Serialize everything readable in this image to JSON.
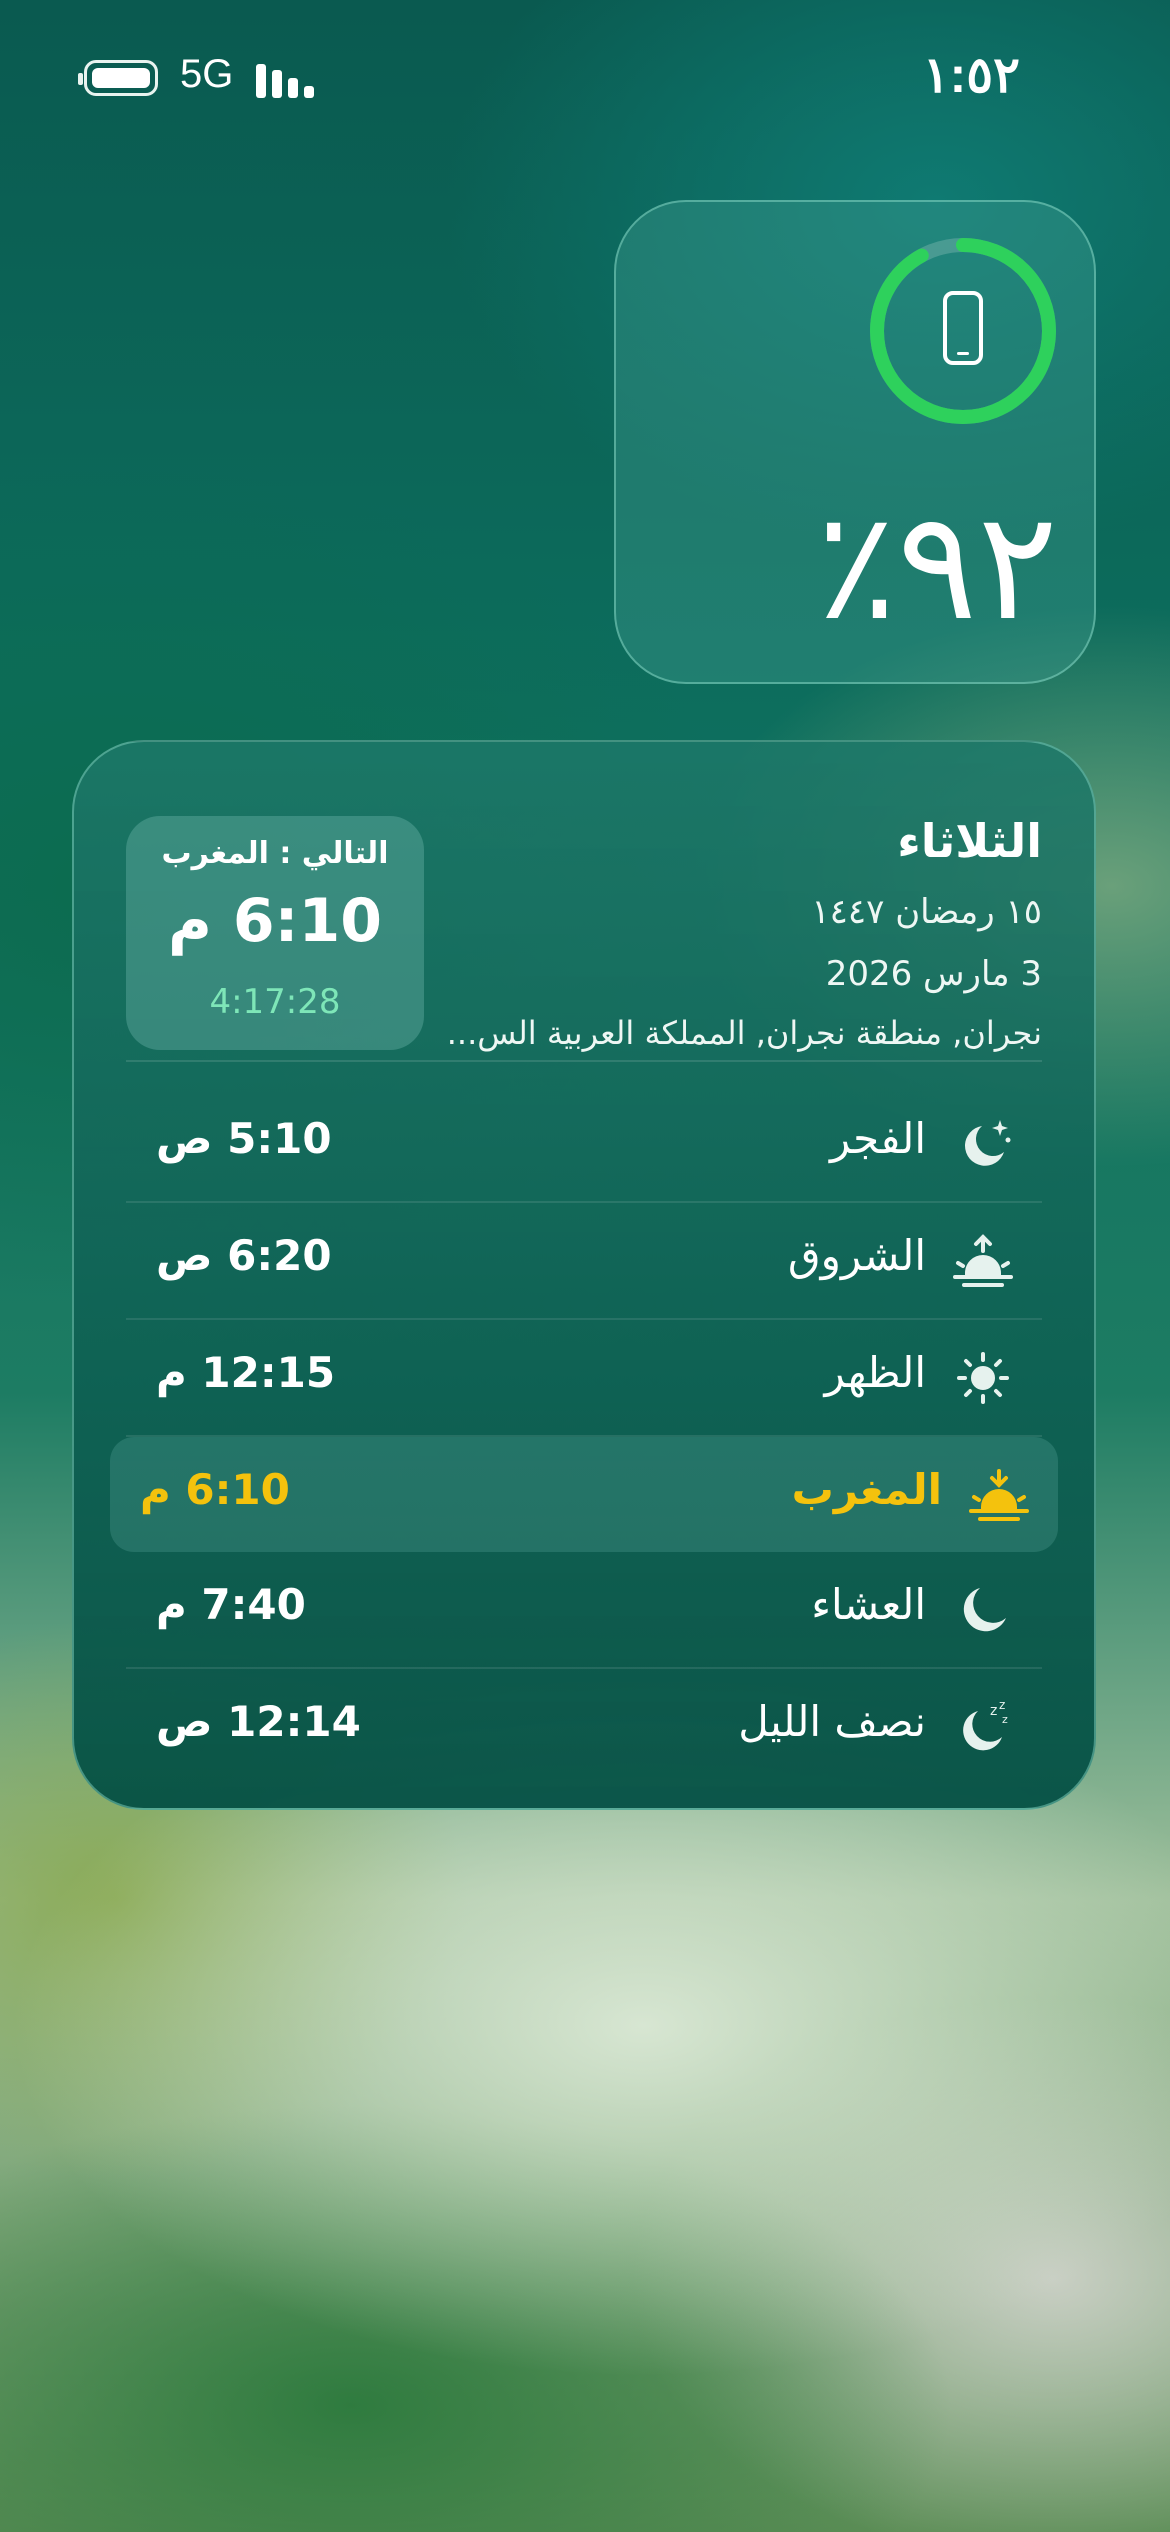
{
  "statusbar": {
    "network": "5G",
    "time": "١:٥٢",
    "signal_bars": 4
  },
  "battery_widget": {
    "percent_text": "٪٩٢",
    "level": 0.92,
    "ring_color": "#2ed15c"
  },
  "prayer_widget": {
    "day": "الثلاثاء",
    "hijri_date": "١٥ رمضان ١٤٤٧",
    "gregorian_date": "3 مارس 2026",
    "location": "نجران, منطقة نجران, المملكة العربية الس...",
    "next": {
      "label": "التالي : المغرب",
      "time": "6:10 م",
      "countdown": "4:17:28"
    },
    "accent_color": "#f4c20d",
    "prayers": [
      {
        "name": "الفجر",
        "time": "5:10 ص",
        "icon": "moon-stars-icon",
        "active": false
      },
      {
        "name": "الشروق",
        "time": "6:20 ص",
        "icon": "sunrise-icon",
        "active": false
      },
      {
        "name": "الظهر",
        "time": "12:15 م",
        "icon": "sun-icon",
        "active": false
      },
      {
        "name": "المغرب",
        "time": "6:10 م",
        "icon": "sunset-icon",
        "active": true
      },
      {
        "name": "العشاء",
        "time": "7:40 م",
        "icon": "moon-icon",
        "active": false
      },
      {
        "name": "نصف الليل",
        "time": "12:14 ص",
        "icon": "moon-zzz-icon",
        "active": false
      }
    ]
  }
}
